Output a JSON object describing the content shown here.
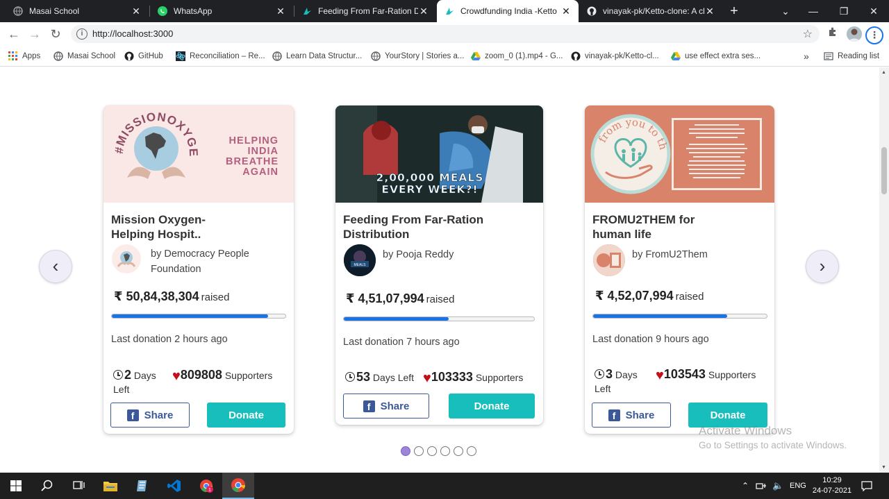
{
  "browser": {
    "tabs": [
      {
        "title": "Masai School",
        "icon": "globe-icon"
      },
      {
        "title": "WhatsApp",
        "icon": "whatsapp-icon"
      },
      {
        "title": "Feeding From Far-Ration Dist",
        "icon": "ketto-icon"
      },
      {
        "title": "Crowdfunding India -Ketto",
        "icon": "ketto-icon",
        "active": true
      },
      {
        "title": "vinayak-pk/Ketto-clone: A clo",
        "icon": "github-icon"
      }
    ],
    "url": "http://localhost:3000",
    "bookmarks": [
      {
        "label": "Apps",
        "icon": "apps-grid-icon"
      },
      {
        "label": "Masai School",
        "icon": "globe-icon"
      },
      {
        "label": "GitHub",
        "icon": "github-icon"
      },
      {
        "label": "Reconciliation – Re...",
        "icon": "react-icon"
      },
      {
        "label": "Learn Data Structur...",
        "icon": "globe-icon"
      },
      {
        "label": "YourStory | Stories a...",
        "icon": "globe-icon"
      },
      {
        "label": "zoom_0 (1).mp4 - G...",
        "icon": "drive-icon"
      },
      {
        "label": "vinayak-pk/Ketto-cl...",
        "icon": "github-icon"
      },
      {
        "label": "use effect extra ses...",
        "icon": "drive-icon"
      }
    ],
    "overflow_label": "»",
    "reading_list": "Reading list"
  },
  "carousel": {
    "prev": "‹",
    "next": "›",
    "dot_count": 6,
    "active_dot": 0,
    "cards": [
      {
        "title": "Mission Oxygen-\nHelping Hospit..",
        "by": "by Democracy People Foundation",
        "raised_amount": "₹ 50,84,38,304",
        "raised_label": "raised",
        "progress": 0.9,
        "last_donation": "Last donation 2 hours ago",
        "days": "2",
        "days_label": "Days Left",
        "supporters": "809808",
        "supporters_label": "Supporters",
        "share": "Share",
        "donate": "Donate",
        "image_text": {
          "hashtag": "#MISSIONOXYGEN",
          "line1": "HELPING",
          "line2": "INDIA",
          "line3": "BREATHE",
          "line4": "AGAIN"
        }
      },
      {
        "title": "Feeding From Far-Ration Distribution",
        "by": "by Pooja Reddy",
        "raised_amount": "₹ 4,51,07,994",
        "raised_label": "raised",
        "progress": 0.55,
        "last_donation": "Last donation 7 hours ago",
        "days": "53",
        "days_label": "Days Left",
        "supporters": "103333",
        "supporters_label": "Supporters",
        "share": "Share",
        "donate": "Donate",
        "image_text": {
          "line1": "2,00,000 MEALS",
          "line2": "EVERY WEEK?!"
        }
      },
      {
        "title": "FROMU2THEM for human life",
        "by": "by FromU2Them",
        "raised_amount": "₹ 4,52,07,994",
        "raised_label": "raised",
        "progress": 0.77,
        "last_donation": "Last donation 9 hours ago",
        "days": "3",
        "days_label": "Days Left",
        "supporters": "103543",
        "supporters_label": "Supporters",
        "share": "Share",
        "donate": "Donate",
        "image_text": {
          "logo": "from you to them"
        }
      }
    ]
  },
  "watermark": {
    "line1": "Activate Windows",
    "line2": "Go to Settings to activate Windows."
  },
  "taskbar": {
    "lang": "ENG",
    "time": "10:29",
    "date": "24-07-2021",
    "badge": "1"
  },
  "colors": {
    "donate": "#17bebb",
    "progress": "#1a73e8",
    "share": "#3b5998",
    "heart": "#c3111b"
  }
}
